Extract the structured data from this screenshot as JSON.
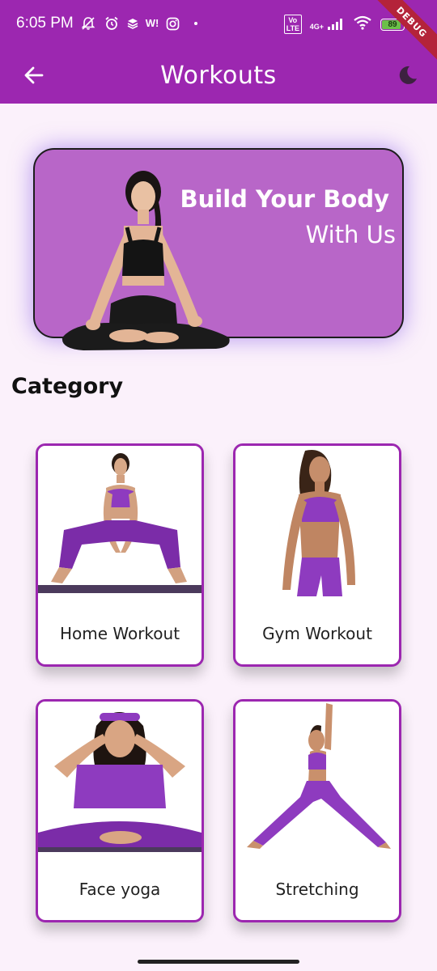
{
  "status_bar": {
    "time": "6:05 PM",
    "carrier_logo": "W!",
    "network_type": "4G+",
    "volte_label": "Vo LTE",
    "battery_level": "89",
    "battery_fraction": 0.89,
    "icons": [
      "muted-bell-icon",
      "alarm-icon",
      "layers-icon",
      "instagram-icon",
      "dot-icon",
      "wifi-icon",
      "signal-icon",
      "battery-icon"
    ]
  },
  "debug_banner": "DEBUG",
  "app_bar": {
    "title": "Workouts",
    "back_icon": "arrow-left-icon",
    "theme_icon": "moon-icon"
  },
  "banner": {
    "title": "Build Your Body",
    "subtitle": "With Us"
  },
  "category": {
    "title": "Category",
    "items": [
      {
        "label": "Home Workout"
      },
      {
        "label": "Gym Workout"
      },
      {
        "label": "Face yoga"
      },
      {
        "label": "Stretching"
      }
    ]
  },
  "colors": {
    "primary": "#9c27b0",
    "banner_bg": "#b866c8",
    "page_bg": "#fbf1fb",
    "outfit_purple": "#8e3bbf",
    "debug_ribbon": "#b4233a"
  }
}
